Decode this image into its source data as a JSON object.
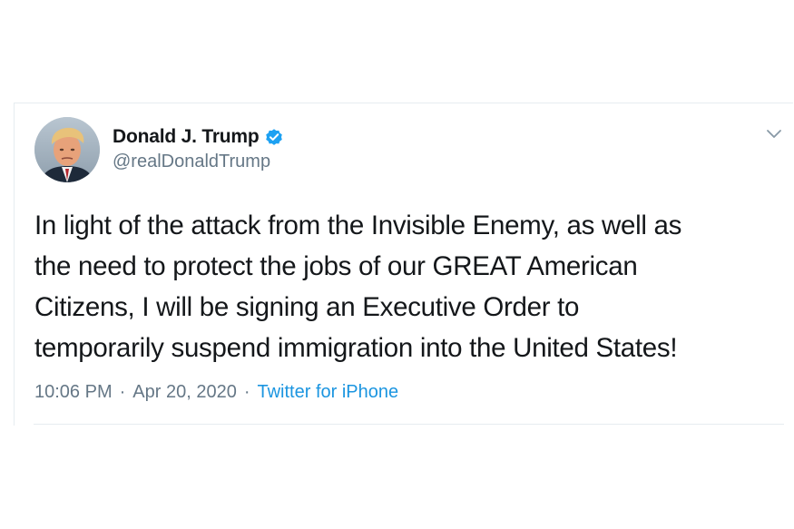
{
  "tweet": {
    "display_name": "Donald J. Trump",
    "handle": "@realDonaldTrump",
    "verified": true,
    "text": "In light of the attack from the Invisible Enemy, as well as\nthe need to protect the jobs of our GREAT American\nCitizens, I will be signing an Executive Order to\ntemporarily suspend immigration into the United States!",
    "time": "10:06 PM",
    "separator": "·",
    "date": "Apr 20, 2020",
    "source": "Twitter for iPhone"
  },
  "icons": {
    "verified": "verified-badge-icon",
    "menu": "chevron-down-icon"
  },
  "colors": {
    "text": "#14171a",
    "secondary": "#657786",
    "link": "#1b95e0",
    "verified": "#1da1f2",
    "border": "#e6ecf0"
  }
}
